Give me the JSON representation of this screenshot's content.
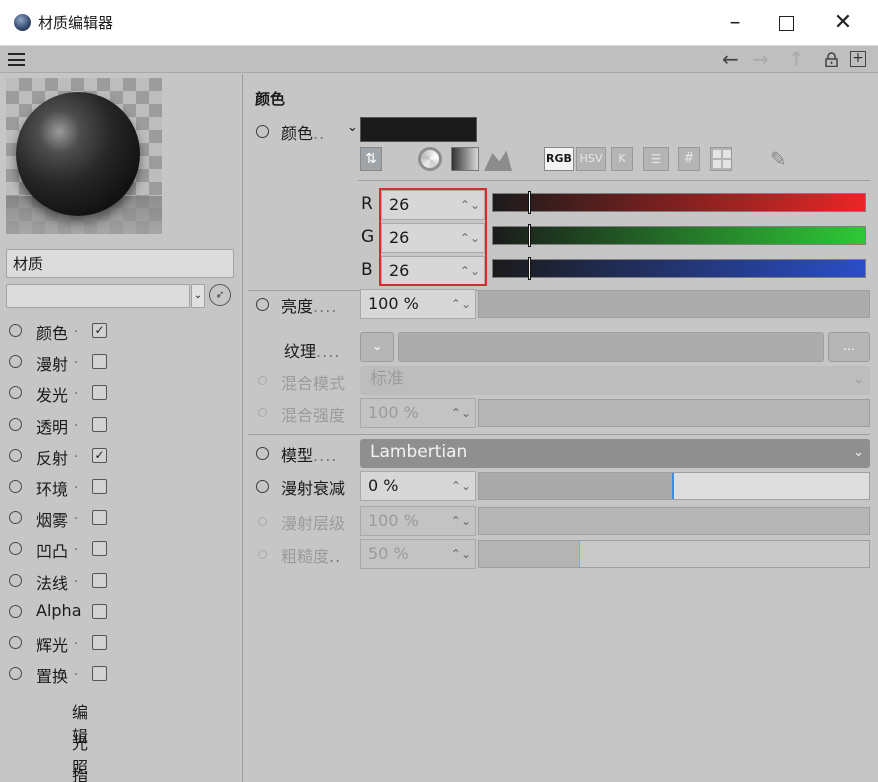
{
  "window": {
    "title": "材质编辑器",
    "minimize": "–",
    "close": "✕"
  },
  "toolbar": {
    "back_glyph": "←",
    "forward_glyph": "→",
    "up_glyph": "↑",
    "new_glyph": "+"
  },
  "left": {
    "material_name": "材质",
    "filter_value": "",
    "channels": [
      {
        "label": "颜色",
        "dots": ".",
        "checked": true
      },
      {
        "label": "漫射",
        "dots": ".",
        "checked": false
      },
      {
        "label": "发光",
        "dots": ".",
        "checked": false
      },
      {
        "label": "透明",
        "dots": ".",
        "checked": false
      },
      {
        "label": "反射",
        "dots": ".",
        "checked": true
      },
      {
        "label": "环境",
        "dots": ".",
        "checked": false
      },
      {
        "label": "烟雾",
        "dots": ".",
        "checked": false
      },
      {
        "label": "凹凸",
        "dots": ".",
        "checked": false
      },
      {
        "label": "法线",
        "dots": ".",
        "checked": false
      },
      {
        "label": "Alpha",
        "dots": "",
        "checked": false
      },
      {
        "label": "辉光",
        "dots": ".",
        "checked": false
      },
      {
        "label": "置换",
        "dots": ".",
        "checked": false
      }
    ],
    "extras": [
      {
        "label": "编辑",
        "dots": "."
      },
      {
        "label": "光照",
        "dots": ""
      },
      {
        "label": "指定",
        "dots": ""
      }
    ]
  },
  "color_section": {
    "title": "颜色",
    "color_label": "颜色",
    "color_dots": "..",
    "color_swatch": "#1a1a1a",
    "mode_labels": {
      "rgb": "RGB",
      "hsv": "HSV",
      "k": "K",
      "hash": "#"
    },
    "channels": [
      {
        "letter": "R",
        "value": "26"
      },
      {
        "letter": "G",
        "value": "26"
      },
      {
        "letter": "B",
        "value": "26"
      }
    ],
    "brightness_label": "亮度",
    "brightness_dots": "....",
    "brightness_value": "100 %",
    "texture_label": "纹理",
    "texture_dots": "....",
    "texture_more": "...",
    "mix_mode_label": "混合模式",
    "mix_mode_value": "标准",
    "mix_strength_label": "混合强度",
    "mix_strength_value": "100 %"
  },
  "model_section": {
    "model_label": "模型",
    "model_dots": "....",
    "model_value": "Lambertian",
    "diffuse_falloff_label": "漫射衰减",
    "diffuse_falloff_value": "0 %",
    "diffuse_falloff_fraction": 0.5,
    "diffuse_level_label": "漫射层级",
    "diffuse_level_value": "100 %",
    "roughness_label": "粗糙度",
    "roughness_dots": "..",
    "roughness_value": "50 %",
    "roughness_fraction": 0.26
  },
  "colors": {
    "accent_red_box": "#d52c2c",
    "panel": "#c6c6c6",
    "slider_marker": "#3d8de0"
  }
}
